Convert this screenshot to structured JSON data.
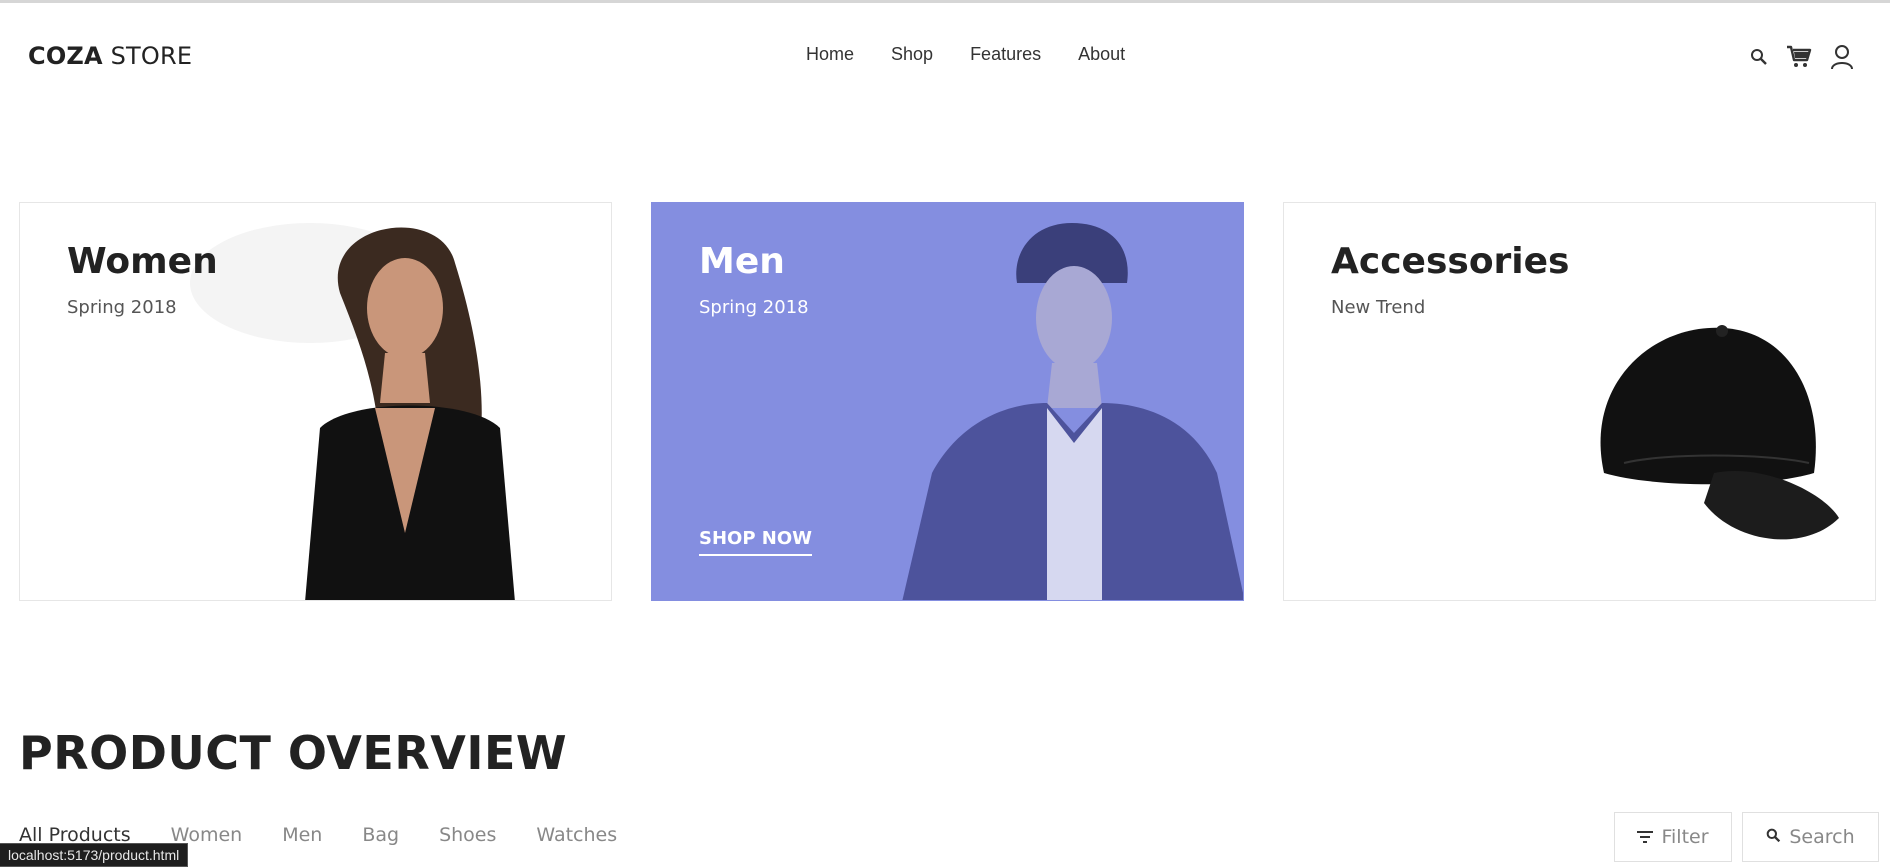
{
  "header": {
    "logo_bold": "COZA",
    "logo_light": " STORE",
    "nav": [
      "Home",
      "Shop",
      "Features",
      "About"
    ]
  },
  "banners": [
    {
      "title": "Women",
      "subtitle": "Spring 2018"
    },
    {
      "title": "Men",
      "subtitle": "Spring 2018",
      "cta": "SHOP NOW",
      "bg_color": "#848ee0"
    },
    {
      "title": "Accessories",
      "subtitle": "New Trend"
    }
  ],
  "overview": {
    "title": "PRODUCT OVERVIEW",
    "categories": [
      "All Products",
      "Women",
      "Men",
      "Bag",
      "Shoes",
      "Watches"
    ],
    "filter_label": "Filter",
    "search_label": "Search"
  },
  "statusbar": {
    "url": "localhost:5173/product.html"
  },
  "icons": [
    "search-icon",
    "cart-icon",
    "user-icon",
    "filter-icon"
  ]
}
